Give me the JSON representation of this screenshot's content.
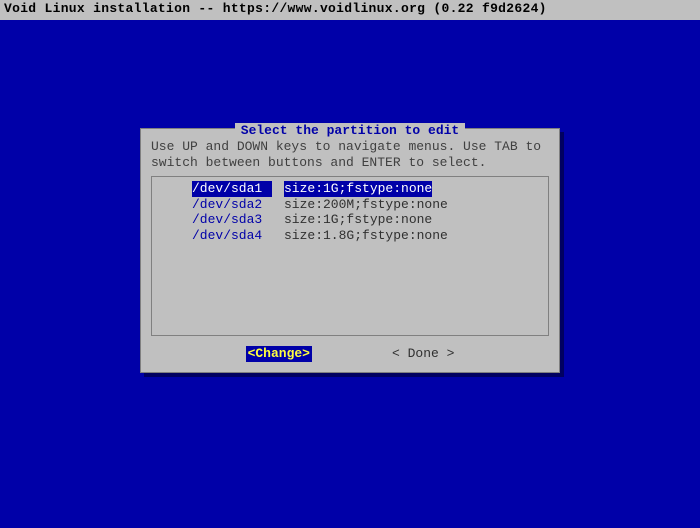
{
  "topbar": "Void Linux installation -- https://www.voidlinux.org (0.22 f9d2624)",
  "dialog": {
    "title": "Select the partition to edit",
    "instructions": "Use UP and DOWN keys to navigate menus. Use TAB to\nswitch between buttons and ENTER to select.",
    "partitions": [
      {
        "dev": "/dev/sda1",
        "info": "size:1G;fstype:none"
      },
      {
        "dev": "/dev/sda2",
        "info": "size:200M;fstype:none"
      },
      {
        "dev": "/dev/sda3",
        "info": "size:1G;fstype:none"
      },
      {
        "dev": "/dev/sda4",
        "info": "size:1.8G;fstype:none"
      }
    ],
    "selected_index": 0,
    "buttons": {
      "change": "<Change>",
      "done": "< Done >"
    },
    "selected_button": "change"
  }
}
